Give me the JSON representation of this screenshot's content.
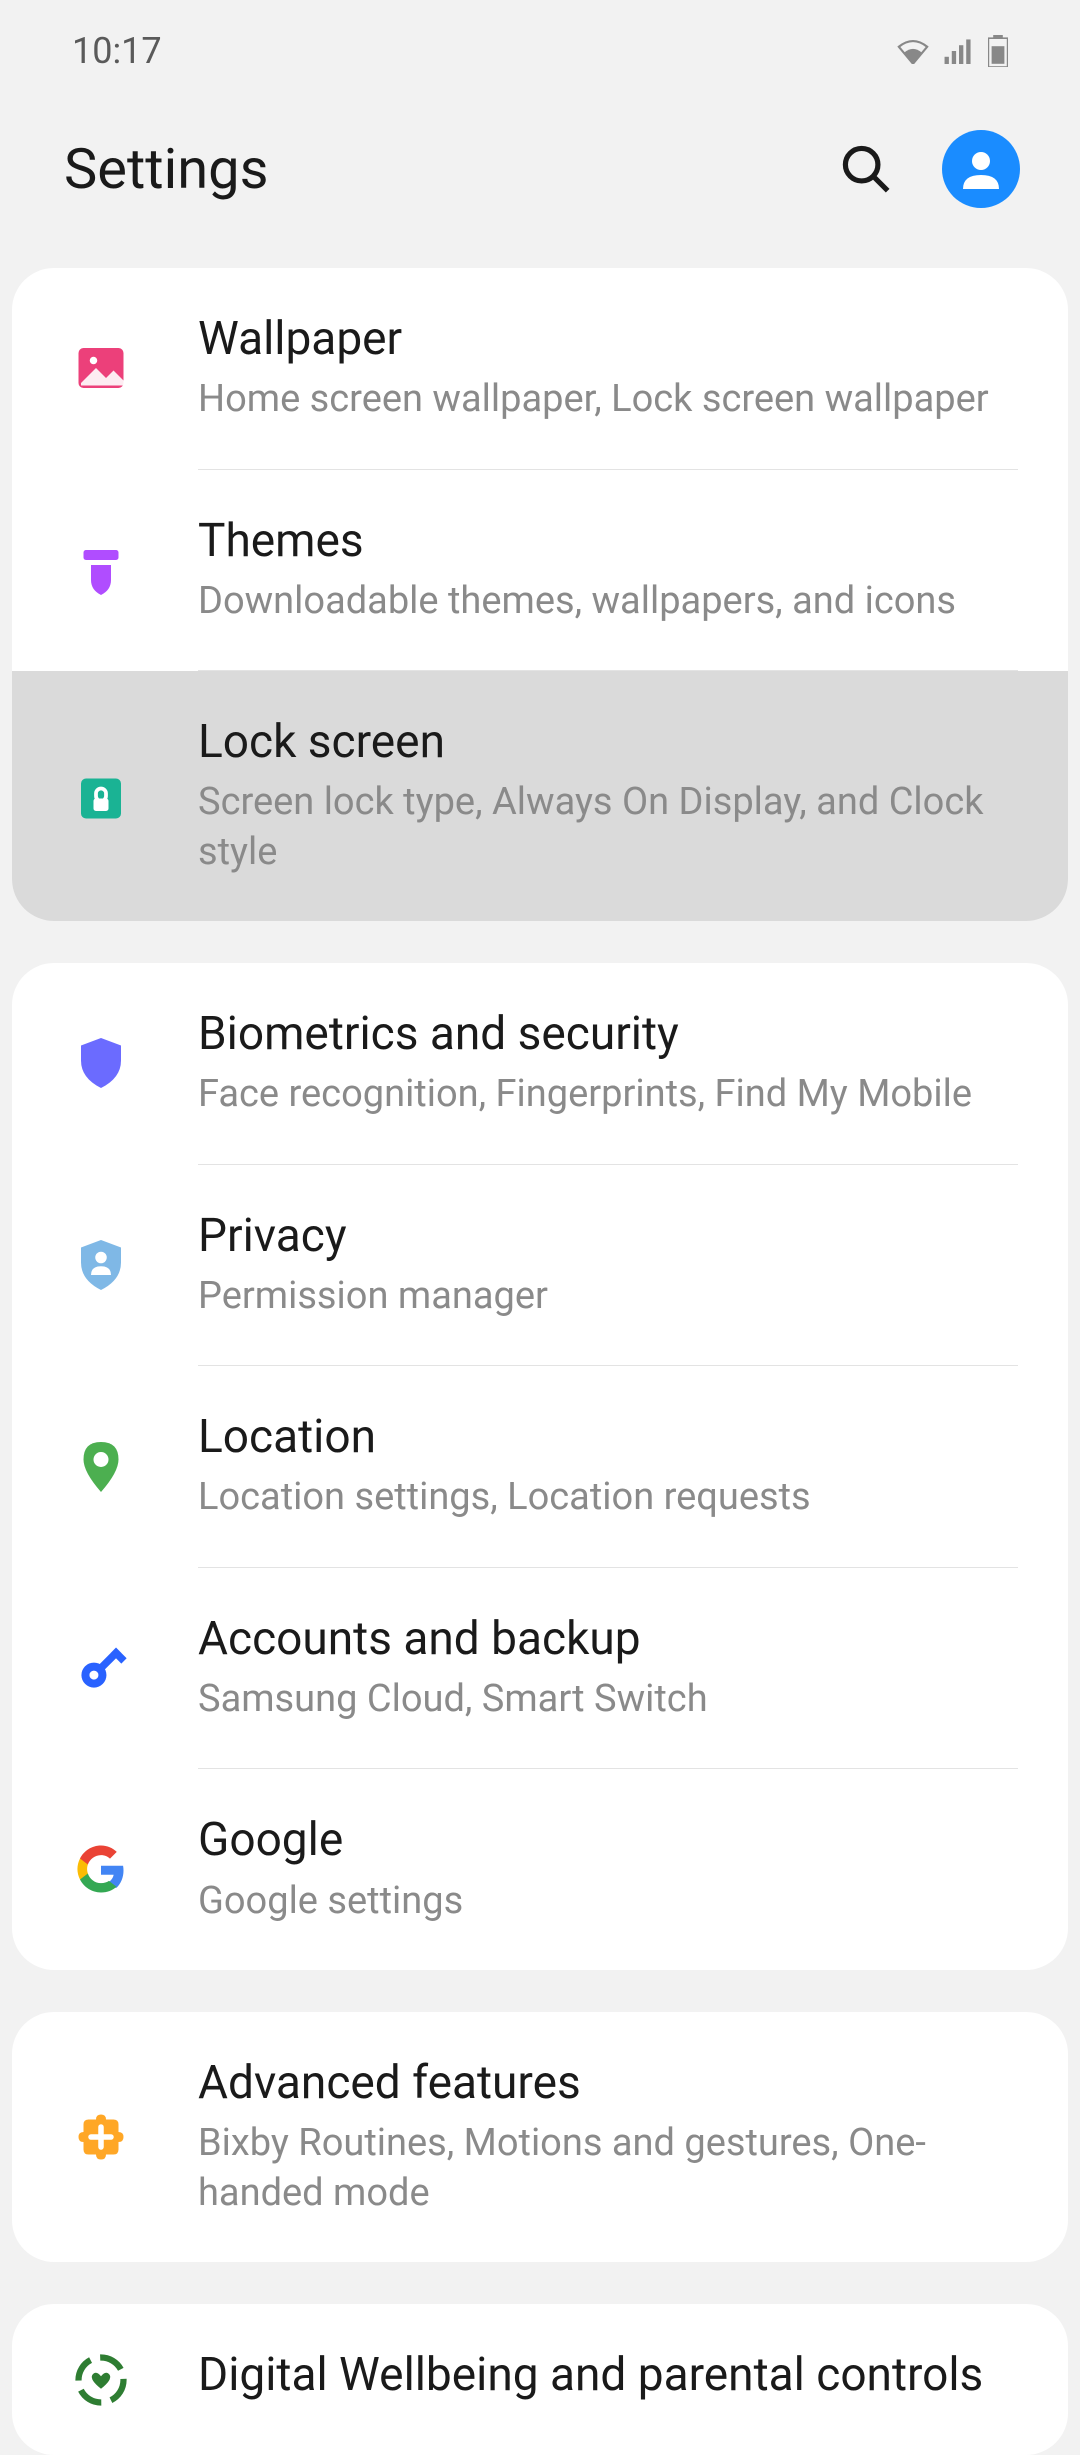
{
  "status": {
    "time": "10:17"
  },
  "header": {
    "title": "Settings"
  },
  "groups": [
    {
      "items": [
        {
          "icon": "image",
          "color": "#ec407a",
          "title": "Wallpaper",
          "subtitle": "Home screen wallpaper, Lock screen wallpaper",
          "highlighted": false
        },
        {
          "icon": "brush",
          "color": "#b04dff",
          "title": "Themes",
          "subtitle": "Downloadable themes, wallpapers, and icons",
          "highlighted": false
        },
        {
          "icon": "lock",
          "color": "#1ab394",
          "title": "Lock screen",
          "subtitle": "Screen lock type, Always On Display, and Clock style",
          "highlighted": true
        }
      ]
    },
    {
      "items": [
        {
          "icon": "shield",
          "color": "#6b6bff",
          "title": "Biometrics and security",
          "subtitle": "Face recognition, Fingerprints, Find My Mobile",
          "highlighted": false
        },
        {
          "icon": "shield-person",
          "color": "#7fb8e6",
          "title": "Privacy",
          "subtitle": "Permission manager",
          "highlighted": false
        },
        {
          "icon": "pin",
          "color": "#4caf50",
          "title": "Location",
          "subtitle": "Location settings, Location requests",
          "highlighted": false
        },
        {
          "icon": "key",
          "color": "#2962ff",
          "title": "Accounts and backup",
          "subtitle": "Samsung Cloud, Smart Switch",
          "highlighted": false
        },
        {
          "icon": "google",
          "color": "#4285f4",
          "title": "Google",
          "subtitle": "Google settings",
          "highlighted": false
        }
      ]
    },
    {
      "items": [
        {
          "icon": "plus-puzzle",
          "color": "#ffa726",
          "title": "Advanced features",
          "subtitle": "Bixby Routines, Motions and gestures, One-handed mode",
          "highlighted": false
        }
      ]
    },
    {
      "items": [
        {
          "icon": "wellbeing",
          "color": "#2e7d32",
          "title": "Digital Wellbeing and parental controls",
          "subtitle": "",
          "highlighted": false
        }
      ]
    }
  ]
}
